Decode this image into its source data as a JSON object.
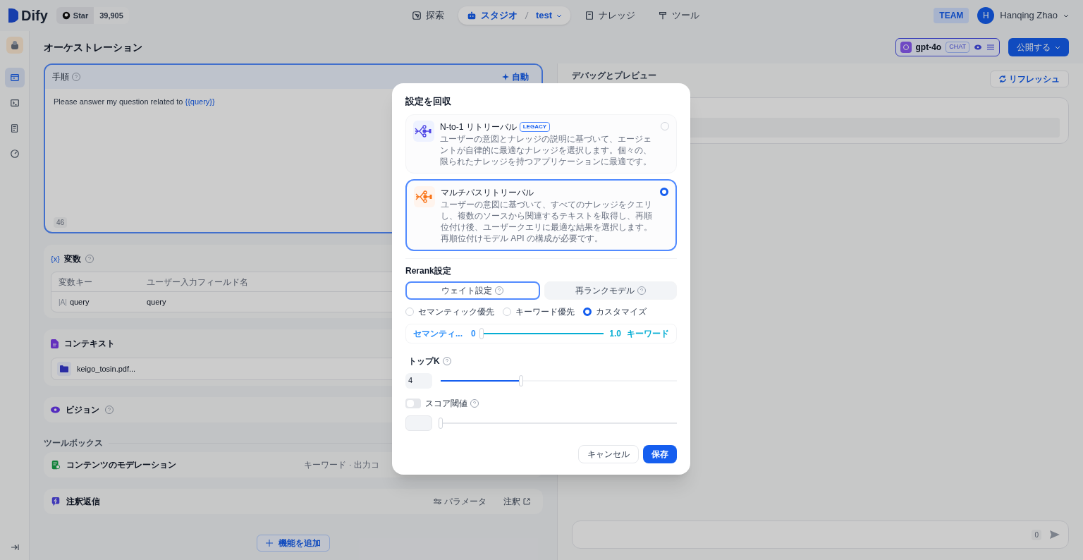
{
  "header": {
    "logo": "Dify",
    "github": {
      "label": "Star",
      "count": "39,905"
    },
    "nav": [
      {
        "kind": "explore",
        "label": "探索",
        "selected": false
      },
      {
        "kind": "studio",
        "label": "スタジオ",
        "selected": true,
        "sub": "test"
      },
      {
        "kind": "knowledge",
        "label": "ナレッジ",
        "selected": false
      },
      {
        "kind": "tools",
        "label": "ツール",
        "selected": false
      }
    ],
    "team": "TEAM",
    "user": {
      "initial": "H",
      "name": "Hanqing Zhao"
    }
  },
  "sidebar": {
    "items": [
      {
        "kind": "layout",
        "selected": true
      },
      {
        "kind": "terminal",
        "selected": false
      },
      {
        "kind": "logs",
        "selected": false
      },
      {
        "kind": "gauge",
        "selected": false
      }
    ]
  },
  "orchestration": {
    "title": "オーケストレーション",
    "instructions": {
      "label": "手順",
      "auto": "自動",
      "prompt": "Please answer my question related to",
      "variable": "{{query}}",
      "count": "46"
    },
    "variables": {
      "icon": "{x}",
      "title": "変数",
      "columns": [
        "変数キー",
        "ユーザー入力フィールド名"
      ],
      "rows": [
        {
          "type": "|A|",
          "key": "query",
          "name": "query"
        }
      ]
    },
    "context": {
      "title": "コンテキスト",
      "files": [
        "keigo_tosin.pdf..."
      ]
    },
    "vision": {
      "title": "ビジョン"
    },
    "toolbox": {
      "title": "ツールボックス",
      "items": [
        {
          "kind": "moderation",
          "title": "コンテンツのモデレーション",
          "detail": "キーワード · 出力コ"
        },
        {
          "kind": "annotation",
          "title": "注釈返信",
          "actions": [
            "パラメータ",
            "注釈"
          ]
        }
      ]
    },
    "add_feature": "機能を追加"
  },
  "model": {
    "name": "gpt-4o",
    "mode": "CHAT"
  },
  "publish": "公開する",
  "debug": {
    "title": "デバッグとプレビュー",
    "refresh": "リフレッシュ",
    "count": "0"
  },
  "dialog": {
    "title": "設定を回収",
    "options": [
      {
        "kind": "single",
        "title": "N-to-1 リトリーバル",
        "badge": "LEGACY",
        "description": "ユーザーの意図とナレッジの説明に基づいて、エージェントが自律的に最適なナレッジを選択します。個々の、限られたナレッジを持つアプリケーションに最適です。",
        "selected": false
      },
      {
        "kind": "multi",
        "title": "マルチパスリトリーバル",
        "description": "ユーザーの意図に基づいて、すべてのナレッジをクエリし、複数のソースから関連するテキストを取得し、再順位付け後、ユーザークエリに最適な結果を選択します。再順位付けモデル API の構成が必要です。",
        "selected": true
      }
    ],
    "rerank_title": "Rerank設定",
    "tabs": [
      {
        "label": "ウェイト設定",
        "selected": true
      },
      {
        "label": "再ランクモデル",
        "selected": false
      }
    ],
    "presets": [
      {
        "label": "セマンティック優先",
        "selected": false
      },
      {
        "label": "キーワード優先",
        "selected": false
      },
      {
        "label": "カスタマイズ",
        "selected": true
      }
    ],
    "weight": {
      "semantic_label": "セマンティ...",
      "semantic_value": "0",
      "keyword_value": "1.0",
      "keyword_label": "キーワード",
      "level": 0
    },
    "top_k": {
      "label": "トップK",
      "value": "4",
      "level": 0.34
    },
    "score": {
      "label": "スコア閾値",
      "on": false,
      "level": 0
    },
    "cancel": "キャンセル",
    "save": "保存"
  }
}
